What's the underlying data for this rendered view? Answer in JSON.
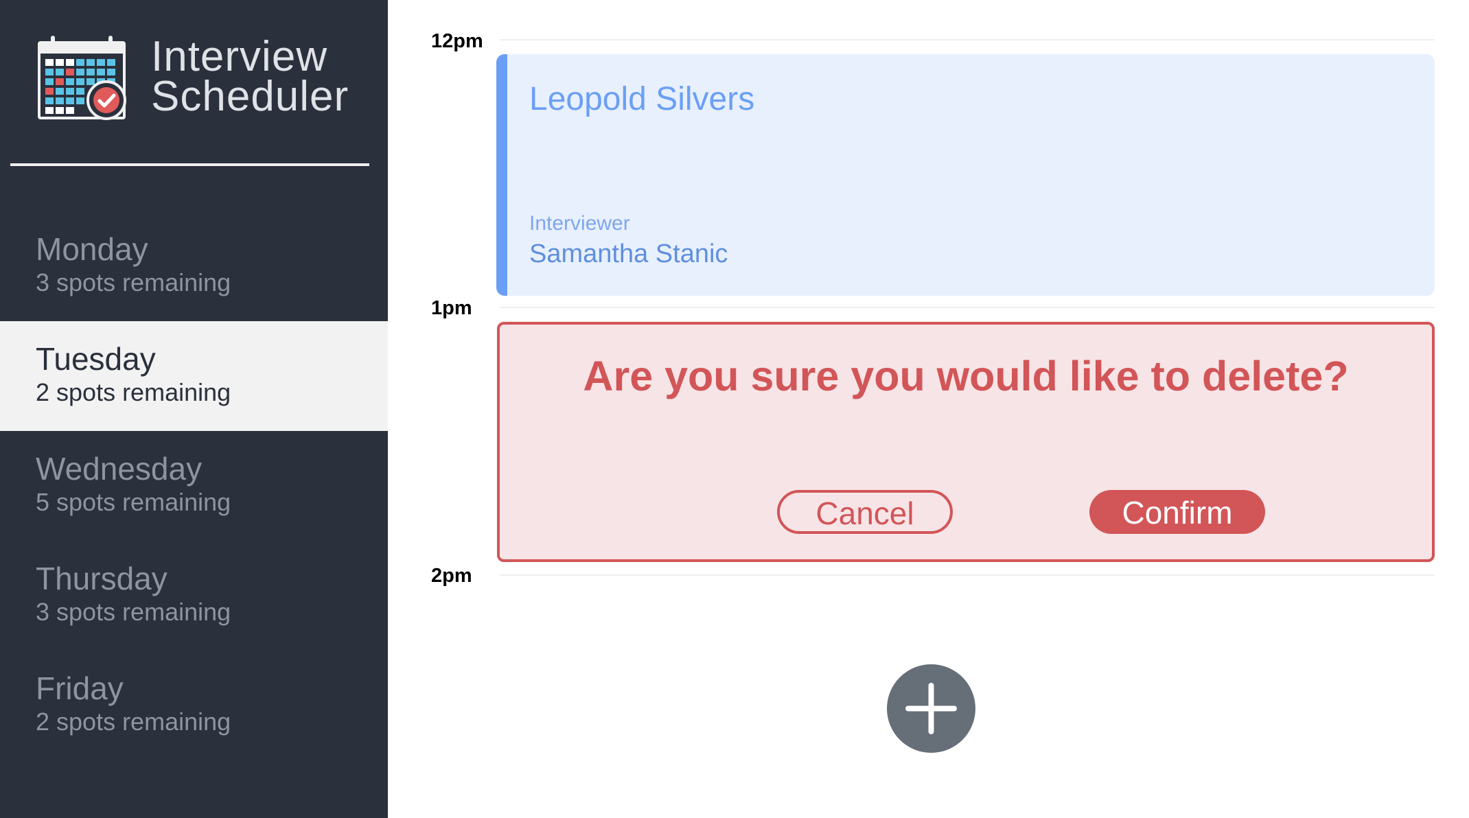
{
  "app": {
    "title_line1": "Interview",
    "title_line2": "Scheduler",
    "logo_icon": "calendar-check-icon"
  },
  "sidebar": {
    "days": [
      {
        "name": "Monday",
        "spots": "3 spots remaining",
        "selected": false
      },
      {
        "name": "Tuesday",
        "spots": "2 spots remaining",
        "selected": true
      },
      {
        "name": "Wednesday",
        "spots": "5 spots remaining",
        "selected": false
      },
      {
        "name": "Thursday",
        "spots": "3 spots remaining",
        "selected": false
      },
      {
        "name": "Friday",
        "spots": "2 spots remaining",
        "selected": false
      }
    ]
  },
  "schedule": {
    "times": [
      "12pm",
      "1pm",
      "2pm"
    ],
    "appointment": {
      "student": "Leopold Silvers",
      "interviewer_label": "Interviewer",
      "interviewer": "Samantha Stanic"
    },
    "confirm_delete": {
      "message": "Are you sure you would like to delete?",
      "cancel_label": "Cancel",
      "confirm_label": "Confirm"
    },
    "add_icon": "plus-icon"
  },
  "colors": {
    "sidebar_bg": "#2a303c",
    "selected_bg": "#f2f2f2",
    "appointment_accent": "#6b9ff5",
    "appointment_bg": "#e8f0fe",
    "danger": "#d25558",
    "danger_bg": "#f7e4e6",
    "add_button": "#666e78"
  }
}
